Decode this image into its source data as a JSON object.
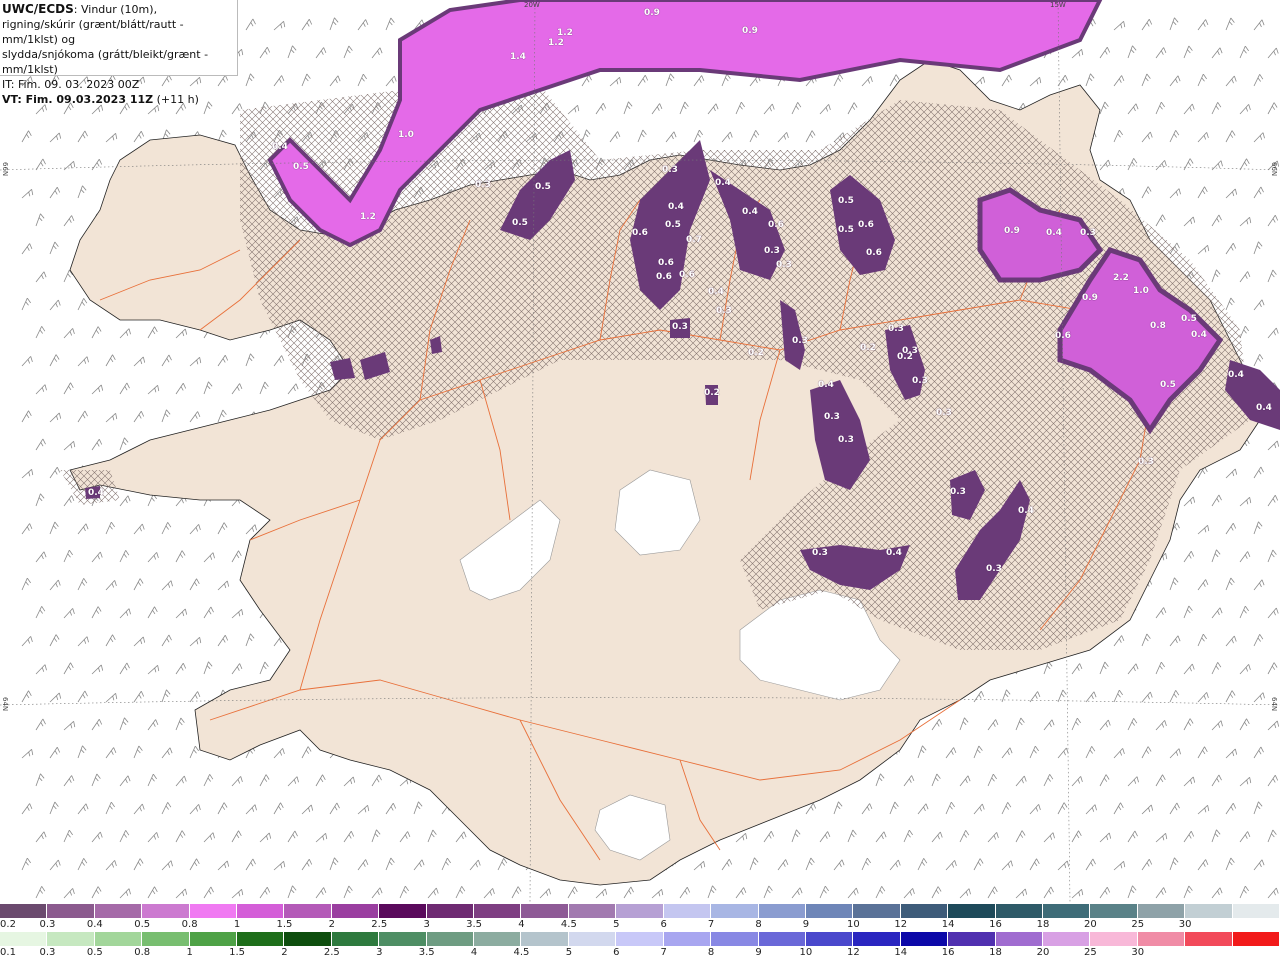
{
  "title": {
    "model": "UWC/ECDS",
    "line1": ": Vindur (10m),",
    "line2": "rigning/skúrir (grænt/blátt/rautt - mm/1klst) og",
    "line3": "slydda/snjókoma (grátt/bleikt/grænt - mm/1klst)",
    "it": "IT: Fim. 09. 03. 2023 00Z",
    "vt_bold": "VT: Fim. 09.03.2023 11Z",
    "vt_rest": " (+11 h)"
  },
  "grid_labels": {
    "lon_20w": "20W",
    "lon_15w": "15W",
    "lat_66n_left": "66N",
    "lat_66n_right": "66N",
    "lat_64n_left": "64N",
    "lat_64n_right": "64N"
  },
  "colors": {
    "land": "#f2e4d6",
    "ice": "#ffffff",
    "roads": "#e8703a",
    "snow_dark": "#6a3a78",
    "snow_mid": "#a45bb0",
    "snow_light": "#e46ae8"
  },
  "map_labels": [
    "0.9",
    "0.9",
    "1.2",
    "1.2",
    "1.4",
    "1.0",
    "0.4",
    "0.5",
    "1.2",
    "0.5",
    "0.5",
    "0.3",
    "0.3",
    "0.6",
    "0.5",
    "0.4",
    "0.7",
    "0.6",
    "0.6",
    "0.4",
    "0.4",
    "0.6",
    "0.6",
    "0.3",
    "0.3",
    "0.4",
    "0.3",
    "0.3",
    "0.5",
    "0.6",
    "0.5",
    "0.6",
    "0.9",
    "0.4",
    "0.3",
    "2.2",
    "1.0",
    "0.9",
    "0.6",
    "0.8",
    "0.5",
    "0.5",
    "0.4",
    "0.4",
    "0.3",
    "0.3",
    "0.3",
    "0.2",
    "0.3",
    "0.2",
    "0.3",
    "0.4",
    "0.3",
    "0.3",
    "0.3",
    "0.2",
    "0.4",
    "0.3",
    "0.4",
    "0.3",
    "0.3",
    "0.4",
    "0.2",
    "0.4"
  ],
  "legend": {
    "snow_scale": [
      "0.2",
      "0.3",
      "0.4",
      "0.5",
      "0.8",
      "1",
      "1.5",
      "2",
      "2.5",
      "3",
      "3.5",
      "4",
      "4.5",
      "5",
      "6",
      "7",
      "8",
      "9",
      "10",
      "12",
      "14",
      "16",
      "18",
      "20",
      "25",
      "30"
    ],
    "snow_colors": [
      "#6b4a6e",
      "#8b5a8e",
      "#a56aa8",
      "#cc7ad0",
      "#f07af2",
      "#d45ed8",
      "#b45ab8",
      "#9a3ea0",
      "#5a0a5c",
      "#6e2a72",
      "#7e3e82",
      "#8e5a96",
      "#a27ab0",
      "#b6a0d4",
      "#c4c6f0",
      "#a8b6e4",
      "#8a9cd0",
      "#6e86b8",
      "#5a7298",
      "#3e5c7a",
      "#1e4a5a",
      "#2e5a68",
      "#3e6c78",
      "#5a8288",
      "#8ea2a8",
      "#c2cfd4",
      "#e4eaec"
    ],
    "rain_scale": [
      "0.1",
      "0.3",
      "0.5",
      "0.8",
      "1",
      "1.5",
      "2",
      "2.5",
      "3",
      "3.5",
      "4",
      "4.5",
      "5",
      "6",
      "7",
      "8",
      "9",
      "10",
      "12",
      "14",
      "16",
      "18",
      "20",
      "25",
      "30"
    ],
    "rain_colors": [
      "#e6f6e2",
      "#c6e8c0",
      "#a2d69a",
      "#78be70",
      "#4ea246",
      "#1e6e1a",
      "#0e4e0e",
      "#2e7a3e",
      "#4e8e64",
      "#6e9c82",
      "#8caca0",
      "#b4c4cc",
      "#d2d8ee",
      "#c8c8f8",
      "#a8a6f0",
      "#8888e4",
      "#6a68d8",
      "#4a48cc",
      "#2a26c0",
      "#0c08a8",
      "#5030b0",
      "#a06cd0",
      "#d8a0e4",
      "#f8b8d8",
      "#f08ca6",
      "#f24a5a",
      "#f21a1a"
    ]
  }
}
